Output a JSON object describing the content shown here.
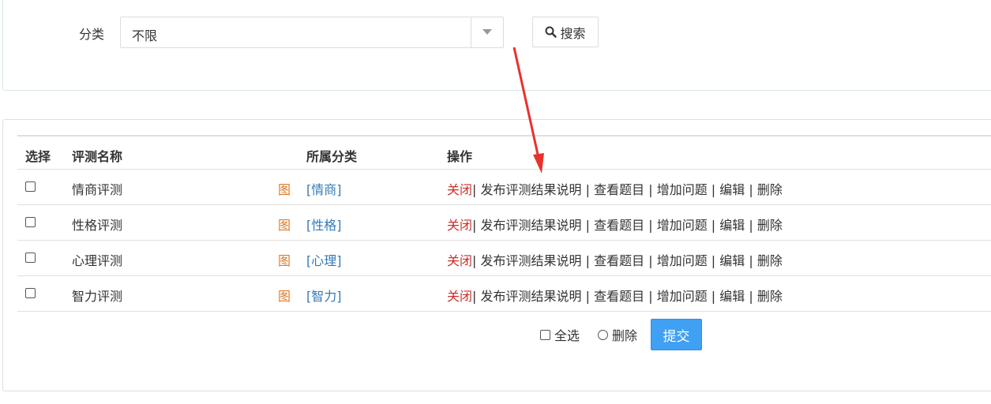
{
  "filter": {
    "label": "分类",
    "select_value": "不限",
    "search_label": "搜索"
  },
  "table": {
    "headers": [
      "选择",
      "评测名称",
      "所属分类",
      "操作"
    ],
    "rows": [
      {
        "name": "情商评测",
        "pic": "图",
        "category": "[情商]"
      },
      {
        "name": "性格评测",
        "pic": "图",
        "category": "[性格]"
      },
      {
        "name": "心理评测",
        "pic": "图",
        "category": "[心理]"
      },
      {
        "name": "智力评测",
        "pic": "图",
        "category": "[智力]"
      }
    ],
    "ops": {
      "close": "关闭",
      "publish": "发布评测结果说明",
      "view": "查看题目",
      "add": "增加问题",
      "edit": "编辑",
      "delete": "删除",
      "separator": "|"
    }
  },
  "footer": {
    "select_all": "全选",
    "delete": "删除",
    "submit": "提交"
  },
  "colors": {
    "accent": "#3fa0f4",
    "close_link": "#c9302c",
    "pic_link": "#e07a28",
    "category_link": "#337ab7",
    "annotation_arrow": "#e8322e"
  }
}
